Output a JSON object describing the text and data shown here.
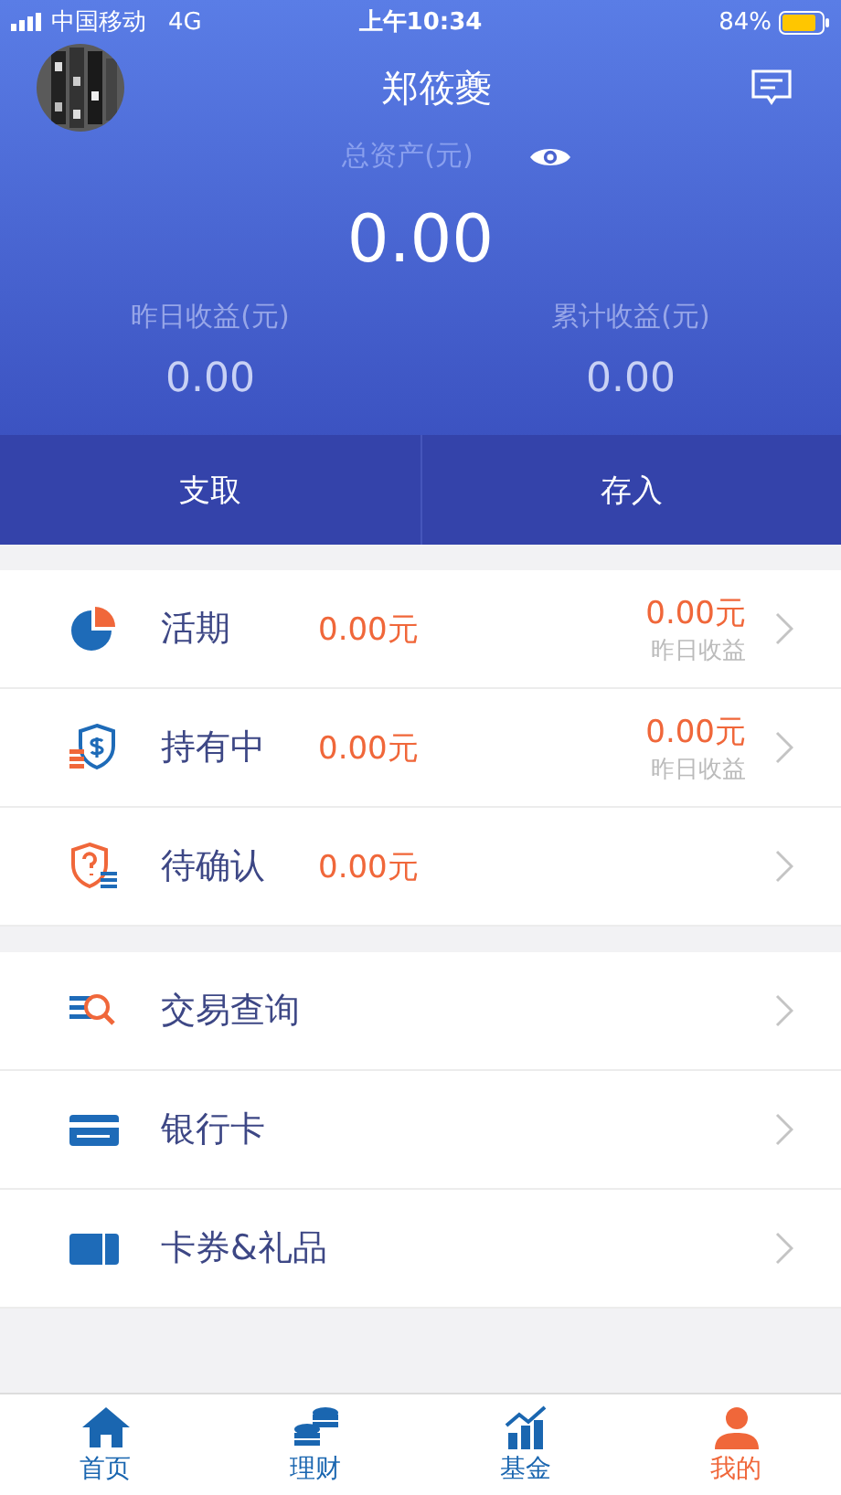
{
  "status_bar": {
    "carrier": "中国移动",
    "network": "4G",
    "time": "上午10:34",
    "battery": "84%"
  },
  "header": {
    "avatar": {
      "kind": "picture"
    },
    "title": "郑筱夔",
    "total_label": "总资产(元)",
    "total": "0.00",
    "stats": [
      {
        "label": "昨日收益(元)",
        "value": "0.00"
      },
      {
        "label": "累计收益(元)",
        "value": "0.00"
      }
    ],
    "actions": [
      "支取",
      "存入"
    ]
  },
  "holdings": [
    {
      "kind": "current",
      "name": "活期",
      "amount": "0.00元",
      "income": "0.00元",
      "income_label": "昨日收益"
    },
    {
      "kind": "holding",
      "name": "持有中",
      "amount": "0.00元",
      "income": "0.00元",
      "income_label": "昨日收益"
    },
    {
      "kind": "pending",
      "name": "待确认",
      "amount": "0.00元"
    }
  ],
  "menu": [
    {
      "kind": "query",
      "name": "交易查询"
    },
    {
      "kind": "card",
      "name": "银行卡"
    },
    {
      "kind": "coupon",
      "name": "卡券&礼品"
    }
  ],
  "tabs": [
    {
      "kind": "home",
      "label": "首页",
      "selected": false
    },
    {
      "kind": "finance",
      "label": "理财",
      "selected": false
    },
    {
      "kind": "fund",
      "label": "基金",
      "selected": false
    },
    {
      "kind": "me",
      "label": "我的",
      "selected": true
    }
  ]
}
